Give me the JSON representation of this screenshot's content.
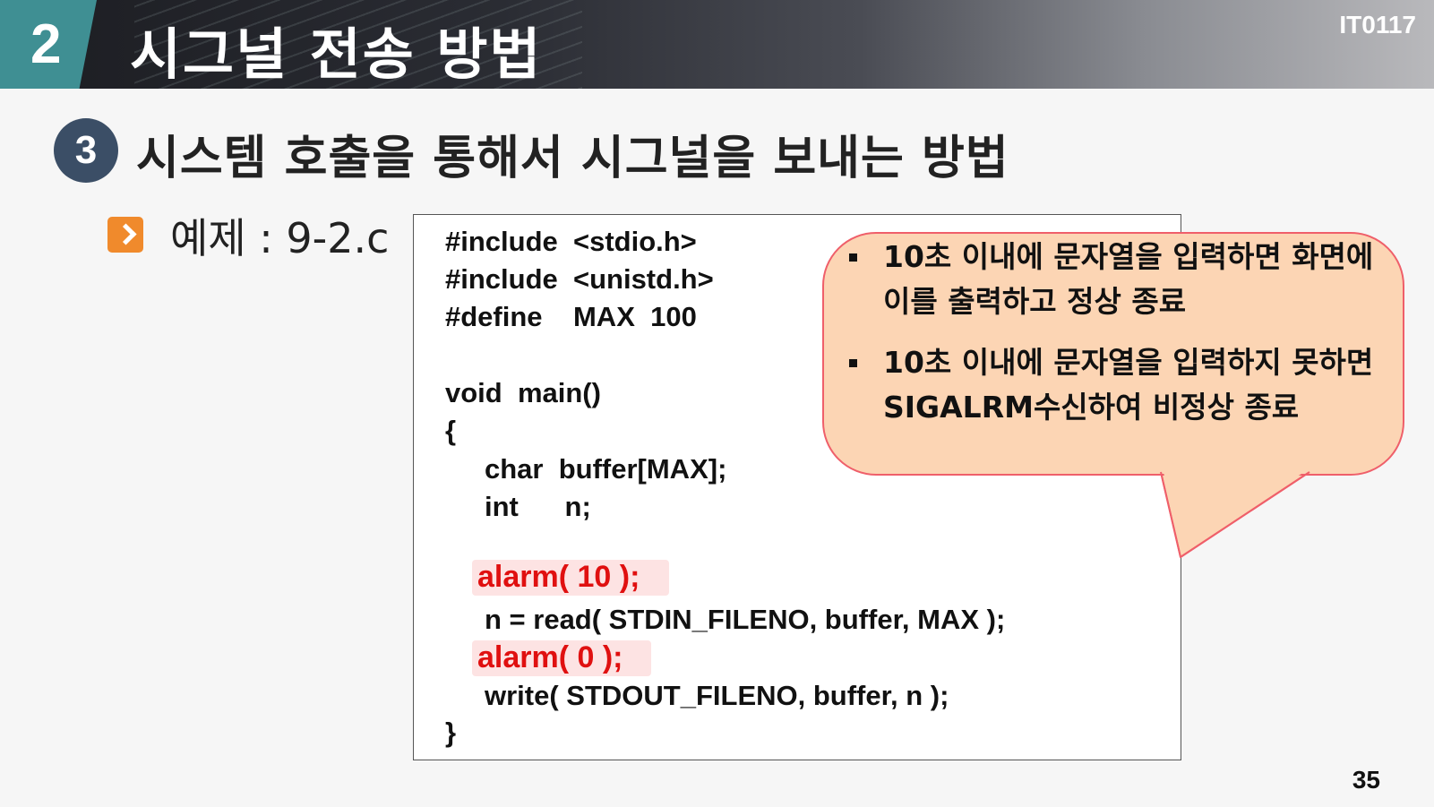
{
  "header": {
    "section_number": "2",
    "title": "시그널 전송 방법",
    "course_code": "IT0117"
  },
  "subheader": {
    "number": "3",
    "title": "시스템 호출을 통해서 시그널을 보내는 방법"
  },
  "example": {
    "icon": "chevron-right-icon",
    "label": "예제 : 9-2.c"
  },
  "code": {
    "lines": [
      "#include  <stdio.h>",
      "#include  <unistd.h>",
      "#define    MAX  100",
      "void  main()",
      "{",
      "char  buffer[MAX];",
      "int      n;",
      "alarm( 10 );",
      "n = read( STDIN_FILENO, buffer, MAX );",
      "alarm( 0 );",
      "write( STDOUT_FILENO, buffer, n );",
      "}"
    ],
    "highlight_color": "#e01010"
  },
  "callout": {
    "bullets": [
      "10초 이내에 문자열을 입력하면 화면에 이를 출력하고 정상 종료",
      "10초 이내에 문자열을 입력하지 못하면 SIGALRM수신하여 비정상 종료"
    ],
    "fill_color": "#fcd5b4",
    "border_color": "#ef5f6a"
  },
  "page_number": "35",
  "colors": {
    "section_accent": "#3f8f93",
    "circle_accent": "#3b4e66",
    "icon_accent": "#f08a2c"
  }
}
